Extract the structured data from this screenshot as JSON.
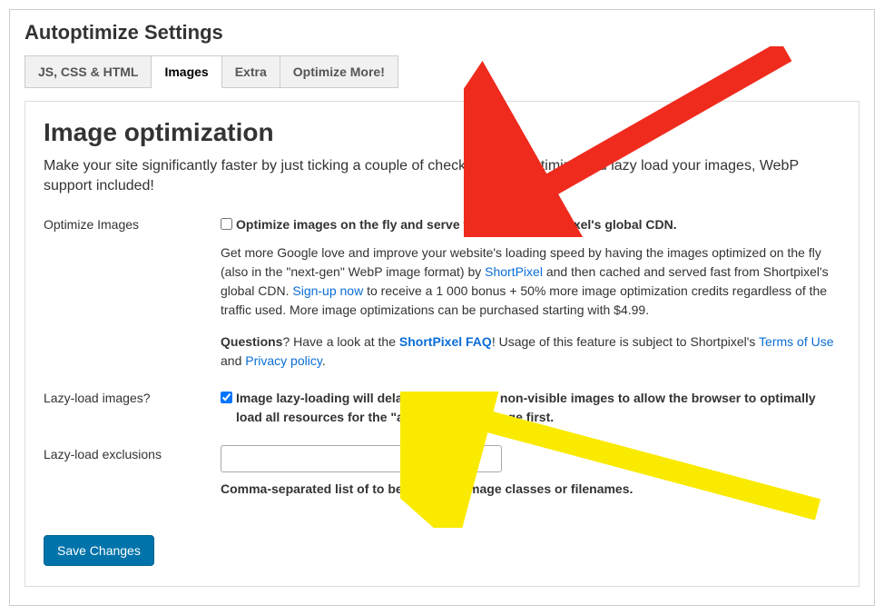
{
  "page_title": "Autoptimize Settings",
  "tabs": [
    {
      "label": "JS, CSS & HTML",
      "active": false
    },
    {
      "label": "Images",
      "active": true
    },
    {
      "label": "Extra",
      "active": false
    },
    {
      "label": "Optimize More!",
      "active": false
    }
  ],
  "section": {
    "heading": "Image optimization",
    "description": "Make your site significantly faster by just ticking a couple of checkboxes to optimize and lazy load your images, WebP support included!"
  },
  "optimize_images": {
    "label": "Optimize Images",
    "checkbox_label": "Optimize images on the fly and serve them from Shortpixel's global CDN.",
    "help_pre": "Get more Google love and improve your website's loading speed by having the images optimized on the fly (also in the \"next-gen\" WebP image format) by ",
    "shortpixel_link": "ShortPixel",
    "help_mid": " and then cached and served fast from Shortpixel's global CDN. ",
    "signup_link": "Sign-up now",
    "help_tail": " to receive a 1 000 bonus + 50% more image optimization credits regardless of the traffic used. More image optimizations can be purchased starting with $4.99.",
    "q_bold": "Questions",
    "q_text1": "? Have a look at the ",
    "faq_link": "ShortPixel FAQ",
    "q_text2": "! Usage of this feature is subject to Shortpixel's ",
    "tos_link": "Terms of Use",
    "q_and": " and ",
    "privacy_link": "Privacy policy",
    "dot": "."
  },
  "lazy_load": {
    "label": "Lazy-load images?",
    "checkbox_label": "Image lazy-loading will delay the loading of non-visible images to allow the browser to optimally load all resources for the \"above the fold\"-page first."
  },
  "exclusions": {
    "label": "Lazy-load exclusions",
    "value": "",
    "hint": "Comma-separated list of to be excluded image classes or filenames."
  },
  "save_button": "Save Changes"
}
